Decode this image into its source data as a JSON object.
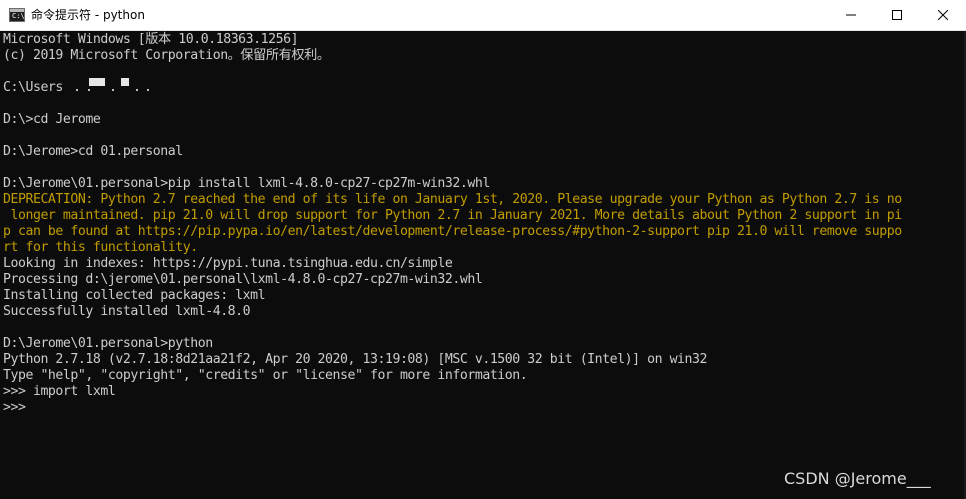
{
  "window": {
    "title": "命令提示符 - python",
    "icon_name": "console-icon",
    "icon_glyph": "C:\\"
  },
  "controls": {
    "minimize_icon": "minimize-icon",
    "maximize_icon": "maximize-icon",
    "close_icon": "close-icon"
  },
  "console": {
    "text_color": "#cccccc",
    "warning_color": "#c19c00",
    "lines": [
      {
        "text": "Microsoft Windows [版本 10.0.18363.1256]",
        "kind": "normal"
      },
      {
        "text": "(c) 2019 Microsoft Corporation。保留所有权利。",
        "kind": "normal"
      },
      {
        "text": "",
        "kind": "normal"
      },
      {
        "text": "C:\\Users",
        "kind": "normal"
      },
      {
        "text": "",
        "kind": "normal"
      },
      {
        "text": "D:\\>cd Jerome",
        "kind": "normal"
      },
      {
        "text": "",
        "kind": "normal"
      },
      {
        "text": "D:\\Jerome>cd 01.personal",
        "kind": "normal"
      },
      {
        "text": "",
        "kind": "normal"
      },
      {
        "text": "D:\\Jerome\\01.personal>pip install lxml-4.8.0-cp27-cp27m-win32.whl",
        "kind": "normal"
      },
      {
        "text": "DEPRECATION: Python 2.7 reached the end of its life on January 1st, 2020. Please upgrade your Python as Python 2.7 is no",
        "kind": "warn"
      },
      {
        "text": " longer maintained. pip 21.0 will drop support for Python 2.7 in January 2021. More details about Python 2 support in pi",
        "kind": "warn"
      },
      {
        "text": "p can be found at https://pip.pypa.io/en/latest/development/release-process/#python-2-support pip 21.0 will remove suppo",
        "kind": "warn"
      },
      {
        "text": "rt for this functionality.",
        "kind": "warn"
      },
      {
        "text": "Looking in indexes: https://pypi.tuna.tsinghua.edu.cn/simple",
        "kind": "normal"
      },
      {
        "text": "Processing d:\\jerome\\01.personal\\lxml-4.8.0-cp27-cp27m-win32.whl",
        "kind": "normal"
      },
      {
        "text": "Installing collected packages: lxml",
        "kind": "normal"
      },
      {
        "text": "Successfully installed lxml-4.8.0",
        "kind": "normal"
      },
      {
        "text": "",
        "kind": "normal"
      },
      {
        "text": "D:\\Jerome\\01.personal>python",
        "kind": "normal"
      },
      {
        "text": "Python 2.7.18 (v2.7.18:8d21aa21f2, Apr 20 2020, 13:19:08) [MSC v.1500 32 bit (Intel)] on win32",
        "kind": "normal"
      },
      {
        "text": "Type \"help\", \"copyright\", \"credits\" or \"license\" for more information.",
        "kind": "normal"
      },
      {
        "text": ">>> import lxml",
        "kind": "normal"
      },
      {
        "text": ">>>",
        "kind": "normal"
      }
    ]
  },
  "watermark": "CSDN @Jerome___"
}
